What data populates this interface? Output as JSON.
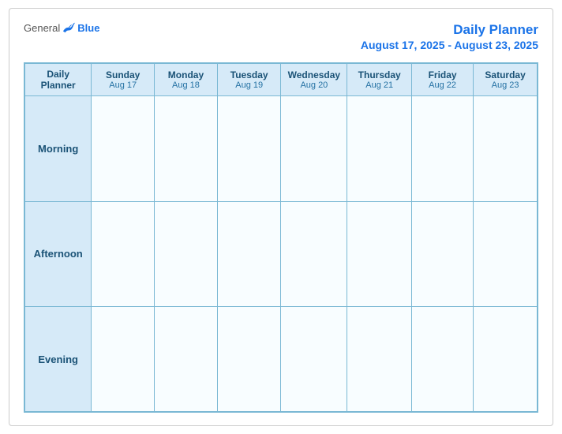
{
  "logo": {
    "general": "General",
    "blue": "Blue"
  },
  "header": {
    "title": "Daily Planner",
    "date_range": "August 17, 2025 - August 23, 2025"
  },
  "table": {
    "label_header": "Daily Planner",
    "days": [
      {
        "name": "Sunday",
        "date": "Aug 17"
      },
      {
        "name": "Monday",
        "date": "Aug 18"
      },
      {
        "name": "Tuesday",
        "date": "Aug 19"
      },
      {
        "name": "Wednesday",
        "date": "Aug 20"
      },
      {
        "name": "Thursday",
        "date": "Aug 21"
      },
      {
        "name": "Friday",
        "date": "Aug 22"
      },
      {
        "name": "Saturday",
        "date": "Aug 23"
      }
    ],
    "rows": [
      {
        "label": "Morning"
      },
      {
        "label": "Afternoon"
      },
      {
        "label": "Evening"
      }
    ]
  }
}
